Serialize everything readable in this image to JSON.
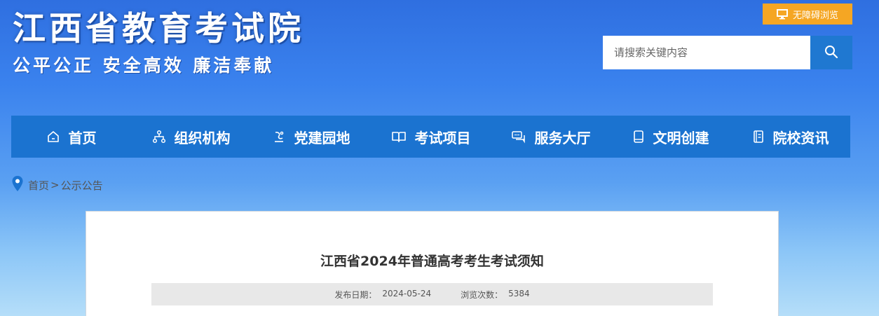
{
  "header": {
    "site_title": "江西省教育考试院",
    "slogan": "公平公正 安全高效 廉洁奉献",
    "accessibility_label": "无障碍浏览",
    "search_placeholder": "请搜索关键内容"
  },
  "nav": {
    "items": [
      {
        "label": "首页",
        "icon": "home-icon"
      },
      {
        "label": "组织机构",
        "icon": "org-chart-icon"
      },
      {
        "label": "党建园地",
        "icon": "party-icon"
      },
      {
        "label": "考试项目",
        "icon": "book-icon"
      },
      {
        "label": "服务大厅",
        "icon": "chat-icon"
      },
      {
        "label": "文明创建",
        "icon": "notebook-icon"
      },
      {
        "label": "院校资讯",
        "icon": "document-icon"
      }
    ]
  },
  "breadcrumb": {
    "home": "首页",
    "separator": ">",
    "current": "公示公告"
  },
  "article": {
    "title": "江西省2024年普通高考考生考试须知",
    "date_label": "发布日期：",
    "date_value": "2024-05-24",
    "views_label": "浏览次数：",
    "views_value": "5384"
  },
  "colors": {
    "nav_bg": "#1b73d0",
    "accessibility_bg": "#f5a623",
    "search_button_bg": "#1f78d1"
  }
}
